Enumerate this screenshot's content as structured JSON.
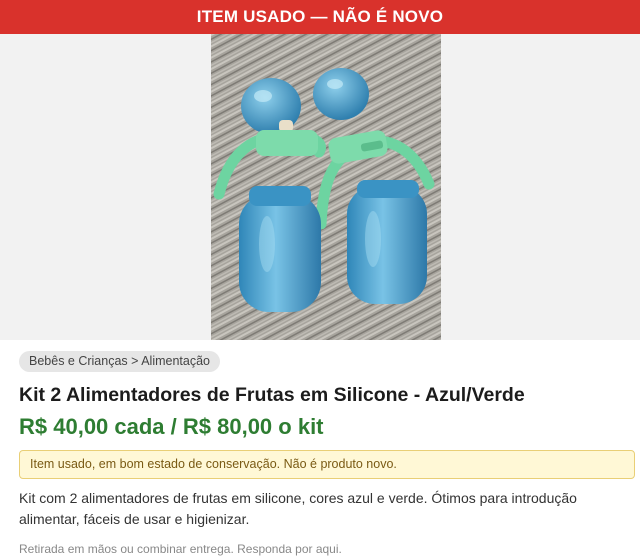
{
  "banner": {
    "text": "ITEM USADO — NÃO É NOVO"
  },
  "photo": {
    "subject": "two blue silicone fruit feeders with green handles on striped fabric"
  },
  "listing": {
    "breadcrumb": "Bebês e Crianças > Alimentação",
    "title": "Kit 2 Alimentadores de Frutas em Silicone - Azul/Verde",
    "price": "R$ 40,00 cada / R$ 80,00 o kit",
    "notice": "Item usado, em bom estado de conservação. Não é produto novo.",
    "description": "Kit com 2 alimentadores de frutas em silicone, cores azul e verde. Ótimos para introdução alimentar, fáceis de usar e higienizar.",
    "footer_note": "Retirada em mãos ou combinar entrega. Responda por aqui."
  },
  "colors": {
    "banner_bg": "#d9322c",
    "price": "#2e7d32",
    "notice_bg": "#fff8d6",
    "notice_border": "#e9cf76"
  }
}
